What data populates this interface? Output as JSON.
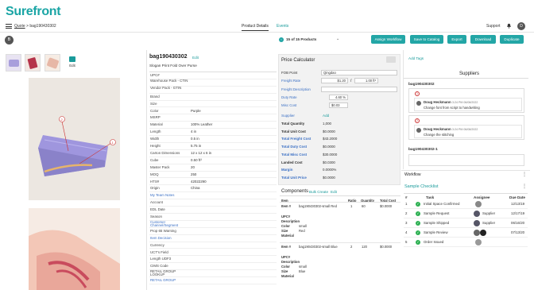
{
  "app": {
    "logo": "Surefront",
    "support": "Support",
    "bell_icon": "bell-icon",
    "avatar_initial": "D"
  },
  "nav": {
    "hamburger_icon": "menu-icon",
    "breadcrumb_root": "Quote",
    "breadcrumb_sep": ">",
    "breadcrumb_current": "bag190430302",
    "tabs": [
      "Product Details",
      "Events"
    ],
    "active_tab": "Product Details"
  },
  "toolbar": {
    "user_initial": "B",
    "pager": "15 of 15 Products",
    "buttons": [
      "Assign Workflow",
      "Save to Catalog",
      "Export",
      "Download",
      "Duplicate"
    ]
  },
  "gallery": {
    "edit_label": "Edit"
  },
  "product": {
    "title": "bag190430302",
    "edit_label": "Edit",
    "subtitle": "Slogan Print Fold Over Purse",
    "attributes": [
      {
        "k": "UPC#",
        "v": ""
      },
      {
        "k": "Warehouse Pack - CTIN",
        "v": ""
      },
      {
        "k": "Vendor Pack - GTIN",
        "v": ""
      },
      {
        "k": "Brand",
        "v": ""
      },
      {
        "k": "Size",
        "v": ""
      },
      {
        "k": "Color",
        "v": "Purple"
      },
      {
        "k": "MSRP",
        "v": ""
      },
      {
        "k": "Material",
        "v": "100% Leather"
      },
      {
        "k": "Length",
        "v": "4 in"
      },
      {
        "k": "Width",
        "v": "0.5 in"
      },
      {
        "k": "Height",
        "v": "5.75 in"
      },
      {
        "k": "Carton Dimensions",
        "v": "12 x 12 x 6 in"
      },
      {
        "k": "Cube",
        "v": "0.50 ft³"
      },
      {
        "k": "Master Pack",
        "v": "20"
      },
      {
        "k": "MOQ",
        "v": "250"
      },
      {
        "k": "HTS#",
        "v": "42022290"
      },
      {
        "k": "Origin",
        "v": "China"
      },
      {
        "k": "My Team Notes",
        "v": ""
      },
      {
        "k": "Account",
        "v": ""
      },
      {
        "k": "EDL Date",
        "v": ""
      },
      {
        "k": "Season",
        "v": ""
      },
      {
        "k": "Customer Channel/Segment",
        "v": ""
      },
      {
        "k": "Prop 65 Warning",
        "v": ""
      },
      {
        "k": "Item Decision",
        "v": ""
      },
      {
        "k": "Currency",
        "v": ""
      },
      {
        "k": "UCT's Field",
        "v": ""
      },
      {
        "k": "Length UDF3",
        "v": ""
      },
      {
        "k": "CIMS Code",
        "v": ""
      },
      {
        "k": "RETAIL GROUP LOOKUP",
        "v": ""
      },
      {
        "k": "RETAIL GROUP",
        "v": ""
      }
    ]
  },
  "price_calc": {
    "title": "Price Calculator",
    "fob_label": "FOB Point",
    "fob_value": "Qingdao",
    "freight_rate_label": "Freight Rate",
    "freight_rate_a": "$1.20",
    "freight_rate_sep": "/",
    "freight_rate_b": "1.00 ft³",
    "freight_desc_label": "Freight Description",
    "duty_rate_label": "Duty Rate",
    "duty_rate_value": "4.60 %",
    "misc_cost_label": "Misc Cost",
    "misc_cost_value": "$0.03",
    "supplier_label": "Supplier",
    "supplier_add": "Add",
    "rows": [
      {
        "k": "Total Quantity",
        "v": "1,000"
      },
      {
        "k": "Total Unit Cost",
        "v": "$0.0000"
      },
      {
        "k": "Total Freight Cost",
        "v": "$43.2000"
      },
      {
        "k": "Total Duty Cost",
        "v": "$0.0000"
      },
      {
        "k": "Total Misc Cost",
        "v": "$30.0000"
      },
      {
        "k": "Landed Cost",
        "v": "$0.0300"
      },
      {
        "k": "Margin",
        "v": "0.0000%"
      },
      {
        "k": "Total Unit Price",
        "v": "$0.0000"
      }
    ]
  },
  "components": {
    "title": "Components",
    "bulk_create": "Bulk Create",
    "edit": "Edit",
    "headers": [
      "Item",
      "Ratio",
      "Quantity",
      "Total Cost"
    ],
    "items": [
      {
        "label": "Item #",
        "name": "bag190430302-small Red",
        "ratio": "1",
        "qty": "60",
        "cost": "$0.0000",
        "upc": "UPC#",
        "desc": "Description",
        "color_k": "Color",
        "color_v": "small",
        "size_k": "Size",
        "size_v": "Red",
        "mat": "Material"
      },
      {
        "label": "Item #",
        "name": "bag190430302-small Blue",
        "ratio": "2",
        "qty": "120",
        "cost": "$0.0000",
        "upc": "UPC#",
        "desc": "Description",
        "color_k": "Color",
        "color_v": "small",
        "size_k": "Size",
        "size_v": "Blue",
        "mat": "Material"
      }
    ]
  },
  "suppliers": {
    "add_tags": "Add Tags",
    "title": "Suppliers",
    "group1": "bag190430302",
    "group2": "bag190430302-1",
    "notes": [
      {
        "num": "1",
        "author": "Doug Heckmann",
        "date": "3:24 PM 06/08/2022",
        "text": "Change font from script to handwriting"
      },
      {
        "num": "2",
        "author": "Doug Heckmann",
        "date": "3:24 PM 06/08/2022",
        "text": "Change the stitching"
      }
    ]
  },
  "workflow": {
    "title": "Workflow",
    "name": "Sample Checklist",
    "headers": [
      "#",
      "Task",
      "Assignee",
      "Due Date"
    ],
    "tasks": [
      {
        "n": "1",
        "task": "Initial Space Confirmed",
        "assignee": "",
        "due": "12/13/19"
      },
      {
        "n": "2",
        "task": "Sample Request",
        "assignee": "Supplier",
        "due": "12/17/19"
      },
      {
        "n": "3",
        "task": "Sample Shipped",
        "assignee": "Supplier",
        "due": "06/16/20"
      },
      {
        "n": "4",
        "task": "Sample Review",
        "assignee": "",
        "due": "07/13/20"
      },
      {
        "n": "5",
        "task": "Order Issued",
        "assignee": "",
        "due": ""
      }
    ]
  },
  "colors": {
    "accent": "#23a6a6",
    "link": "#3a6fc4",
    "check": "#2db052"
  }
}
